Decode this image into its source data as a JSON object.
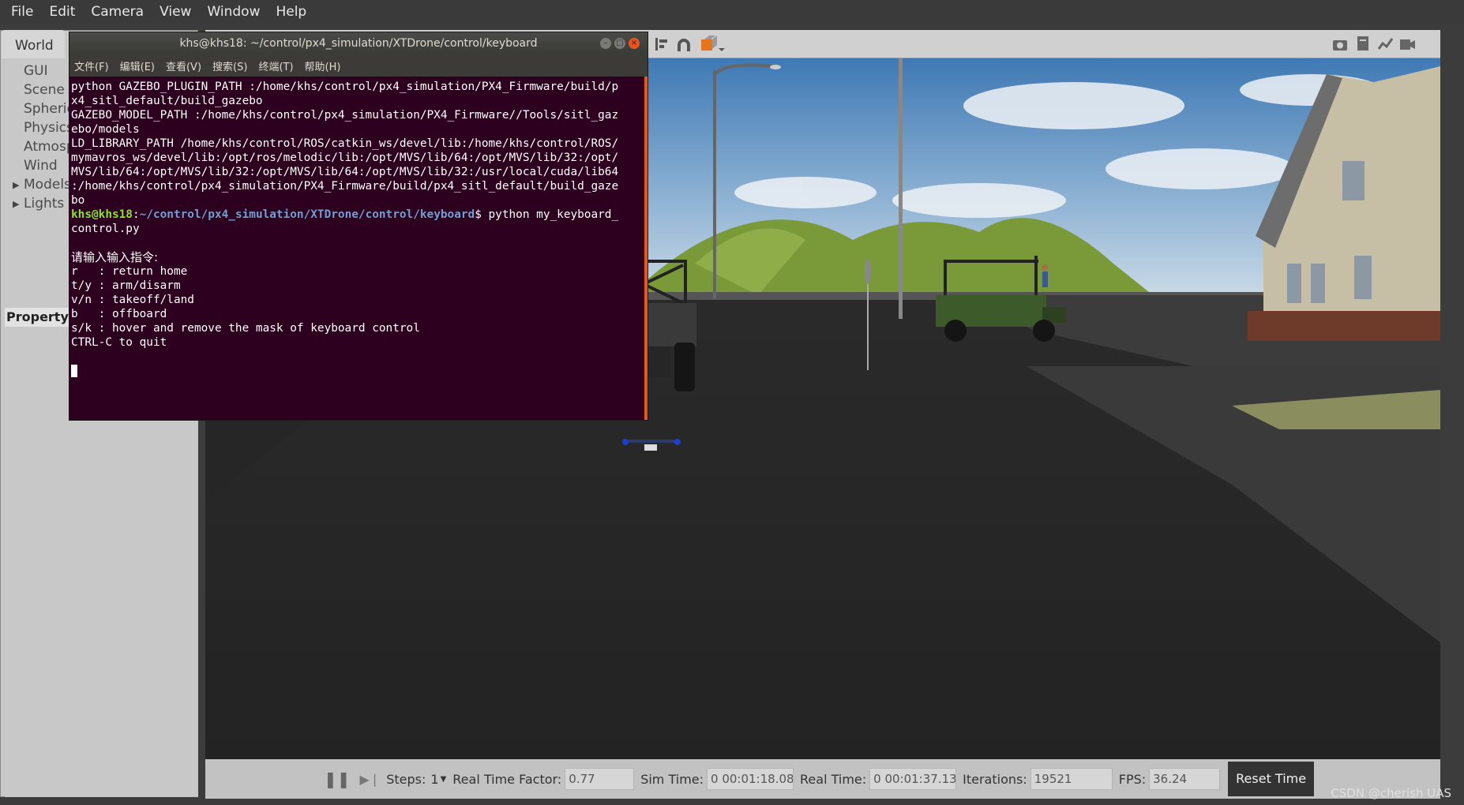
{
  "menubar": {
    "items": [
      "File",
      "Edit",
      "Camera",
      "View",
      "Window",
      "Help"
    ]
  },
  "left_panel": {
    "tab": "World",
    "tree": [
      "GUI",
      "Scene",
      "Spheric",
      "Physics",
      "Atmosp",
      "Wind",
      "Models",
      "Lights"
    ],
    "property_label": "Property"
  },
  "terminal": {
    "title": "khs@khs18: ~/control/px4_simulation/XTDrone/control/keyboard",
    "menu": [
      "文件(F)",
      "编辑(E)",
      "查看(V)",
      "搜索(S)",
      "终端(T)",
      "帮助(H)"
    ],
    "lines_before": [
      "python GAZEBO_PLUGIN_PATH :/home/khs/control/px4_simulation/PX4_Firmware/build/p",
      "x4_sitl_default/build_gazebo",
      "GAZEBO_MODEL_PATH :/home/khs/control/px4_simulation/PX4_Firmware//Tools/sitl_gaz",
      "ebo/models",
      "LD_LIBRARY_PATH /home/khs/control/ROS/catkin_ws/devel/lib:/home/khs/control/ROS/",
      "mymavros_ws/devel/lib:/opt/ros/melodic/lib:/opt/MVS/lib/64:/opt/MVS/lib/32:/opt/",
      "MVS/lib/64:/opt/MVS/lib/32:/opt/MVS/lib/64:/opt/MVS/lib/32:/usr/local/cuda/lib64",
      ":/home/khs/control/px4_simulation/PX4_Firmware/build/px4_sitl_default/build_gaze",
      "bo"
    ],
    "prompt_user": "khs@khs18",
    "prompt_path": "~/control/px4_simulation/XTDrone/control/keyboard",
    "prompt_cmd": "$ python my_keyboard_",
    "prompt_cmd_cont": "control.py",
    "instructions_header": "请输入输入指令:",
    "instructions": [
      "r   : return home",
      "t/y : arm/disarm",
      "v/n : takeoff/land",
      "b   : offboard",
      "s/k : hover and remove the mask of keyboard control",
      "CTRL-C to quit"
    ]
  },
  "bottom_bar": {
    "steps_label": "Steps:",
    "steps_value": "1",
    "rtf_label": "Real Time Factor:",
    "rtf_value": "0.77",
    "sim_time_label": "Sim Time:",
    "sim_time_value": "0 00:01:18.084",
    "real_time_label": "Real Time:",
    "real_time_value": "0 00:01:37.130",
    "iterations_label": "Iterations:",
    "iterations_value": "19521",
    "fps_label": "FPS:",
    "fps_value": "36.24",
    "reset_label": "Reset Time"
  },
  "watermark": "CSDN @cherish UAS"
}
